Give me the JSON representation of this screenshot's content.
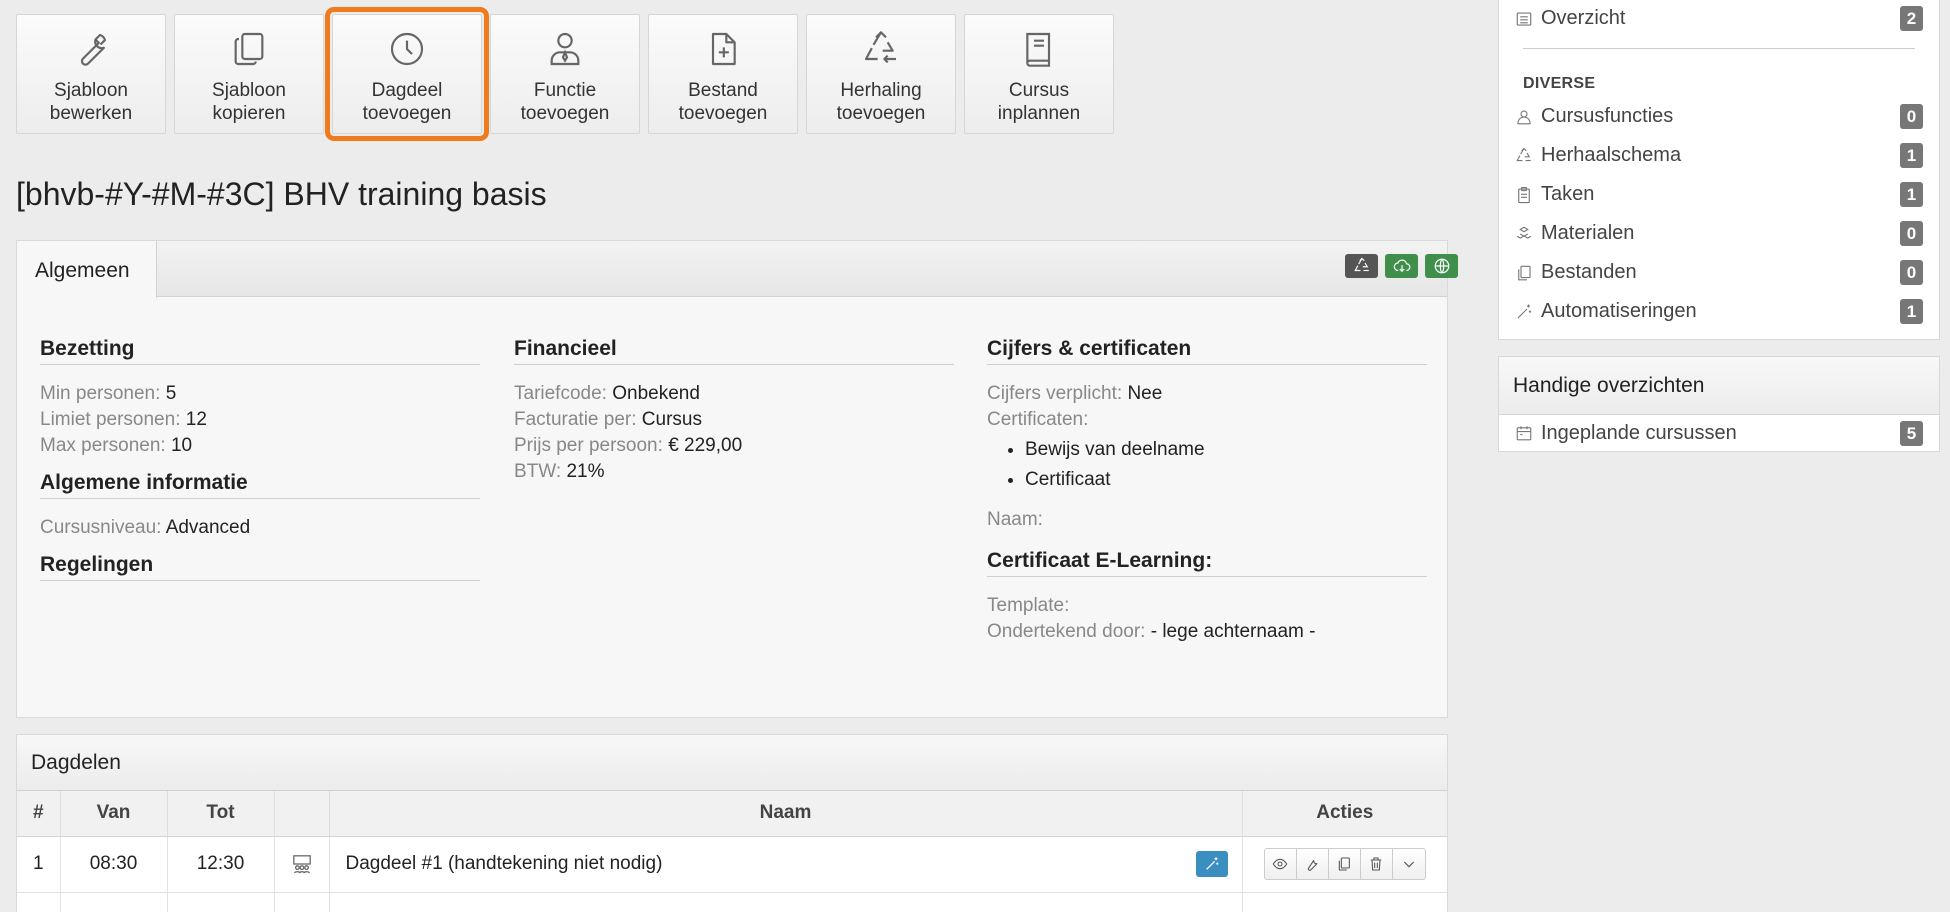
{
  "toolbar": [
    {
      "line1": "Sjabloon",
      "line2": "bewerken",
      "icon": "wrench-icon"
    },
    {
      "line1": "Sjabloon",
      "line2": "kopieren",
      "icon": "copy-icon"
    },
    {
      "line1": "Dagdeel",
      "line2": "toevoegen",
      "icon": "clock-icon"
    },
    {
      "line1": "Functie",
      "line2": "toevoegen",
      "icon": "person-icon"
    },
    {
      "line1": "Bestand",
      "line2": "toevoegen",
      "icon": "file-plus-icon"
    },
    {
      "line1": "Herhaling",
      "line2": "toevoegen",
      "icon": "recycle-icon"
    },
    {
      "line1": "Cursus",
      "line2": "inplannen",
      "icon": "book-icon"
    }
  ],
  "page_title": "[bhvb-#Y-#M-#3C] BHV training basis",
  "tab": "Algemeen",
  "colors": {
    "highlight": "#f07a1e",
    "green": "#3f8f4a",
    "dark": "#555555",
    "blue": "#3b8fc0"
  },
  "bezetting": {
    "heading": "Bezetting",
    "min_k": "Min personen:",
    "min_v": "5",
    "lim_k": "Limiet personen:",
    "lim_v": "12",
    "max_k": "Max personen:",
    "max_v": "10"
  },
  "algemeen_info": {
    "heading": "Algemene informatie",
    "niveau_k": "Cursusniveau:",
    "niveau_v": "Advanced"
  },
  "regelingen": {
    "heading": "Regelingen"
  },
  "financieel": {
    "heading": "Financieel",
    "tarief_k": "Tariefcode:",
    "tarief_v": "Onbekend",
    "fact_k": "Facturatie per:",
    "fact_v": "Cursus",
    "prijs_k": "Prijs per persoon:",
    "prijs_v": "€ 229,00",
    "btw_k": "BTW:",
    "btw_v": "21%"
  },
  "cijfers": {
    "heading": "Cijfers & certificaten",
    "verplicht_k": "Cijfers verplicht:",
    "verplicht_v": "Nee",
    "cert_k": "Certificaten:",
    "certs": [
      "Bewijs van deelname",
      "Certificaat"
    ],
    "naam_k": "Naam:"
  },
  "elearning": {
    "heading": "Certificaat E-Learning:",
    "template_k": "Template:",
    "onder_k": "Ondertekend door:",
    "onder_v": "- lege achternaam -"
  },
  "dagdelen": {
    "title": "Dagdelen",
    "headers": {
      "nr": "#",
      "van": "Van",
      "tot": "Tot",
      "naam": "Naam",
      "acties": "Acties"
    },
    "rows": [
      {
        "nr": "1",
        "van": "08:30",
        "tot": "12:30",
        "naam": "Dagdeel #1 (handtekening niet nodig)"
      }
    ]
  },
  "sidebar": {
    "overzicht": {
      "label": "Overzicht",
      "count": "2"
    },
    "category": "DIVERSE",
    "items": [
      {
        "label": "Cursusfuncties",
        "count": "0"
      },
      {
        "label": "Herhaalschema",
        "count": "1"
      },
      {
        "label": "Taken",
        "count": "1"
      },
      {
        "label": "Materialen",
        "count": "0"
      },
      {
        "label": "Bestanden",
        "count": "0"
      },
      {
        "label": "Automatiseringen",
        "count": "1"
      }
    ],
    "handig": {
      "title": "Handige overzichten",
      "items": [
        {
          "label": "Ingeplande cursussen",
          "count": "5"
        }
      ]
    }
  }
}
